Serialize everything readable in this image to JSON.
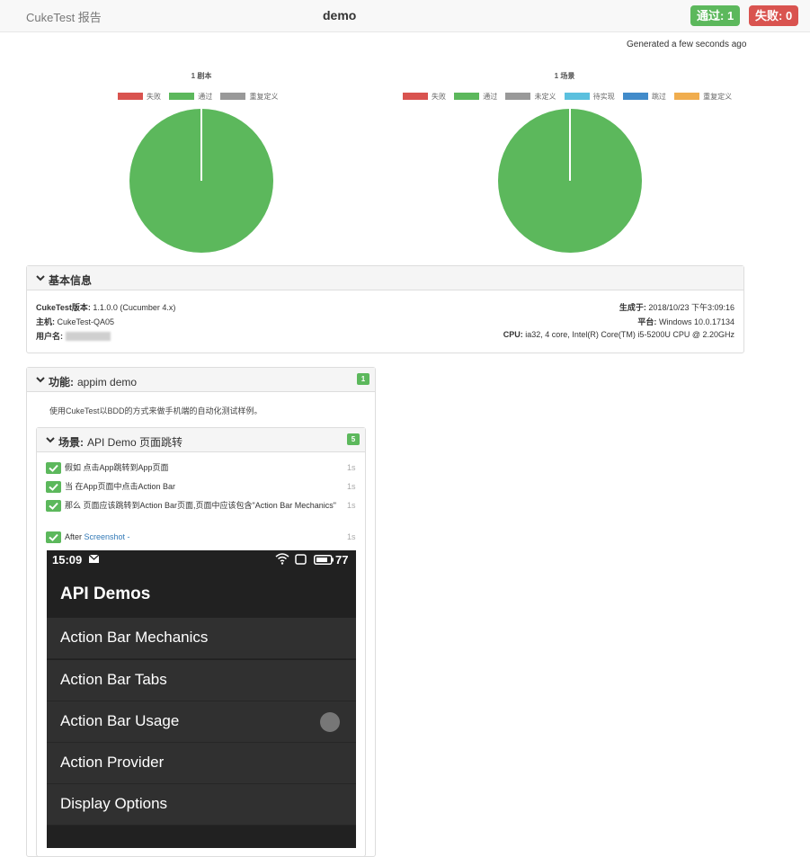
{
  "navbar": {
    "brand": "CukeTest 报告",
    "title": "demo",
    "passed_badge": "通过: 1",
    "failed_badge": "失败: 0"
  },
  "generated": "Generated a few seconds ago",
  "charts": {
    "features": {
      "title": "1 剧本",
      "legend": [
        {
          "label": "失败",
          "color": "#d9534f"
        },
        {
          "label": "通过",
          "color": "#5cb85c"
        },
        {
          "label": "重复定义",
          "color": "#999999"
        }
      ]
    },
    "scenarios": {
      "title": "1 场景",
      "legend": [
        {
          "label": "失败",
          "color": "#d9534f"
        },
        {
          "label": "通过",
          "color": "#5cb85c"
        },
        {
          "label": "未定义",
          "color": "#999999"
        },
        {
          "label": "待实现",
          "color": "#5bc0de"
        },
        {
          "label": "跳过",
          "color": "#428bca"
        },
        {
          "label": "重复定义",
          "color": "#f0ad4e"
        }
      ]
    }
  },
  "chart_data": [
    {
      "type": "pie",
      "title": "1 剧本",
      "categories": [
        "失败",
        "通过",
        "重复定义"
      ],
      "values": [
        0,
        1,
        0
      ]
    },
    {
      "type": "pie",
      "title": "1 场景",
      "categories": [
        "失败",
        "通过",
        "未定义",
        "待实现",
        "跳过",
        "重复定义"
      ],
      "values": [
        0,
        1,
        0,
        0,
        0,
        0
      ]
    }
  ],
  "basic_info": {
    "heading": "基本信息",
    "version_label": "CukeTest版本:",
    "version_value": "1.1.0.0 (Cucumber 4.x)",
    "host_label": "主机:",
    "host_value": "CukeTest-QA05",
    "user_label": "用户名:",
    "generated_label": "生成于:",
    "generated_value": "2018/10/23 下午3:09:16",
    "platform_label": "平台:",
    "platform_value": "Windows 10.0.17134",
    "cpu_label": "CPU:",
    "cpu_value": "ia32, 4 core, Intel(R) Core(TM) i5-5200U CPU @ 2.20GHz"
  },
  "feature": {
    "label": "功能:",
    "name": "appim demo",
    "count": "1",
    "description": "使用CukeTest以BDD的方式来做手机端的自动化测试样例。",
    "scenario": {
      "label": "场景:",
      "name": "API Demo 页面跳转",
      "count": "5",
      "steps": [
        {
          "text": "假如 点击App跳转到App页面",
          "duration": "1s"
        },
        {
          "text": "当 在App页面中点击Action Bar",
          "duration": "1s"
        },
        {
          "text": "那么 页面应该跳转到Action Bar页面,页面中应该包含\"Action Bar Mechanics\"",
          "duration": "1s"
        }
      ],
      "after": {
        "prefix": "After",
        "link": "Screenshot -",
        "duration": "1s"
      }
    }
  },
  "screenshot": {
    "time": "15:09",
    "battery": "77",
    "app_title": "API Demos",
    "items": [
      "Action Bar Mechanics",
      "Action Bar Tabs",
      "Action Bar Usage",
      "Action Provider",
      "Display Options"
    ]
  },
  "colors": {
    "pass": "#5cb85c",
    "fail": "#d9534f"
  }
}
